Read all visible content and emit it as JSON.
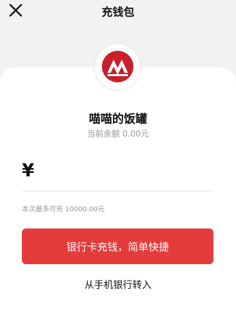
{
  "header": {
    "title": "充钱包"
  },
  "account": {
    "name": "喵喵的饭罐",
    "balance_text": "当前余额 0.00元"
  },
  "recharge": {
    "currency_symbol": "¥",
    "amount_value": "",
    "limit_text": "本次最多可充 10000.00元"
  },
  "actions": {
    "primary_label": "银行卡充钱，简单快捷",
    "transfer_label": "从手机银行转入"
  },
  "icons": {
    "close": "close-icon",
    "bank_logo": "bank-logo"
  },
  "colors": {
    "accent": "#e33c3a",
    "logo_red": "#c8202a"
  }
}
